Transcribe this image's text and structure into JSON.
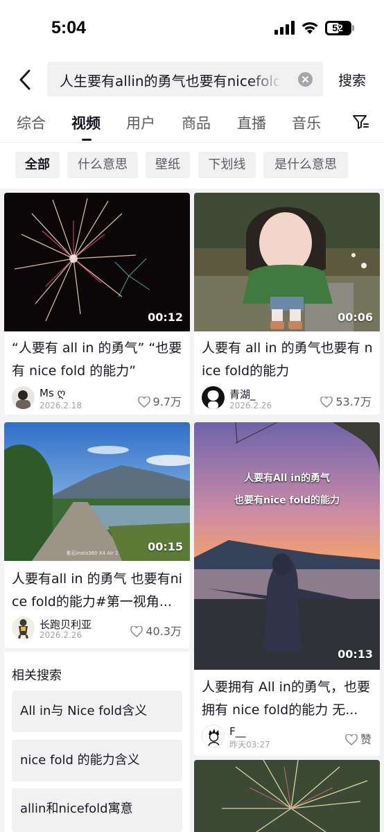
{
  "status": {
    "time": "5:04",
    "battery": "52"
  },
  "search": {
    "query": "人生要有allin的勇气也要有nicefold的能力",
    "button": "搜索"
  },
  "tabs": [
    {
      "label": "综合"
    },
    {
      "label": "视频"
    },
    {
      "label": "用户"
    },
    {
      "label": "商品"
    },
    {
      "label": "直播"
    },
    {
      "label": "音乐"
    }
  ],
  "active_tab": "视频",
  "chips": [
    "全部",
    "什么意思",
    "壁纸",
    "下划线",
    "是什么意思"
  ],
  "videos": [
    {
      "duration": "00:12",
      "title": "“人要有 all  in 的勇气” “也要有 nice  fold 的能力”",
      "author": "Ms ღ",
      "date": "2026.2.18",
      "likes": "9.7万"
    },
    {
      "duration": "00:06",
      "title": "人要有 all in 的勇气也要有 nice fold的能力",
      "author": "青湖_",
      "date": "2026.2.26",
      "likes": "53.7万"
    },
    {
      "duration": "00:15",
      "title": "人要有all in 的勇气 也要有nice fold的能力#第一视角...",
      "author": "长跑贝利亚",
      "date": "2026.2.26",
      "likes": "40.3万",
      "watermark": "影石Insta360 X4 Air 2"
    },
    {
      "duration": "00:13",
      "title": "人要拥有 All in的勇气，也要拥有 nice fold的能力 无...",
      "author": "F__",
      "date": "昨天03:27",
      "likes": "赞",
      "overlay_line1": "人要有All in的勇气",
      "overlay_line2": "也要有nice fold的能力"
    }
  ],
  "related": {
    "heading": "相关搜索",
    "items": [
      "All in与 Nice fold含义",
      "nice fold 的能力含义",
      "allin和nicefold寓意"
    ]
  }
}
